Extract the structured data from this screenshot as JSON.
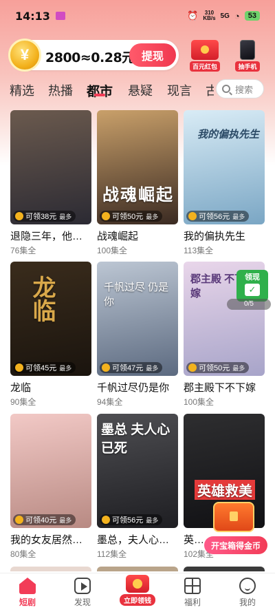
{
  "status_bar": {
    "time": "14:13",
    "net_speed": "310",
    "net_unit": "KB/s",
    "signal": "5G",
    "battery": "53"
  },
  "header": {
    "coin_amount": "2800≈0.28元",
    "withdraw_label": "提现",
    "promo_red_packet": "百元红包",
    "promo_phone": "抽手机"
  },
  "tabs": [
    {
      "label": "精选"
    },
    {
      "label": "热播"
    },
    {
      "label": "都市"
    },
    {
      "label": "悬疑"
    },
    {
      "label": "现言"
    },
    {
      "label": "古"
    }
  ],
  "search": {
    "placeholder": "搜索"
  },
  "dramas": [
    {
      "title": "退隐三年，他…",
      "episodes": "76集全",
      "reward": "可领38元",
      "reward_max": "最多",
      "colors": [
        "#6b5a4e",
        "#2b2a33"
      ]
    },
    {
      "title": "战魂崛起",
      "episodes": "100集全",
      "reward": "可领50元",
      "reward_max": "最多",
      "colors": [
        "#c9a06a",
        "#3a2a22"
      ],
      "poster_text": "战魂崛起"
    },
    {
      "title": "我的偏执先生",
      "episodes": "113集全",
      "reward": "可领56元",
      "reward_max": "最多",
      "colors": [
        "#d9ecf6",
        "#7aa6c4"
      ],
      "poster_text": "我的偏执先生"
    },
    {
      "title": "龙临",
      "episodes": "90集全",
      "reward": "可领45元",
      "reward_max": "最多",
      "colors": [
        "#3a2c1c",
        "#1a140e"
      ],
      "poster_text": "龙临"
    },
    {
      "title": "千帆过尽仍是你",
      "episodes": "94集全",
      "reward": "可领47元",
      "reward_max": "最多",
      "colors": [
        "#bcc6d3",
        "#5c6a80"
      ],
      "poster_text": "千帆过尽 仍是你"
    },
    {
      "title": "郡主殿下不下嫁",
      "episodes": "100集全",
      "reward": "可领50元",
      "reward_max": "最多",
      "colors": [
        "#e9d6ea",
        "#a7a4c9"
      ],
      "poster_text": "郡主殿 不下嫁"
    },
    {
      "title": "我的女友居然…",
      "episodes": "80集全",
      "reward": "可领40元",
      "reward_max": "最多",
      "colors": [
        "#f2c9c6",
        "#b88a83"
      ]
    },
    {
      "title": "墨总，夫人心…",
      "episodes": "112集全",
      "reward": "可领56元",
      "reward_max": "最多",
      "colors": [
        "#4e4e52",
        "#1e1e22"
      ],
      "poster_text": "墨总 夫人心已死"
    },
    {
      "title": "英雄救美",
      "episodes": "102集全",
      "reward": "",
      "reward_max": "",
      "colors": [
        "#2e2e30",
        "#111114"
      ],
      "poster_text": "英雄救美"
    }
  ],
  "float_widget": {
    "title": "领现",
    "check": "✓",
    "progress": "0/5"
  },
  "treasure": {
    "label": "开宝箱得金币"
  },
  "bottom_nav": [
    {
      "label": "短剧",
      "icon": "home-icon"
    },
    {
      "label": "发现",
      "icon": "play-icon"
    },
    {
      "label": "立即领钱",
      "icon": "red-envelope-icon"
    },
    {
      "label": "福利",
      "icon": "gift-icon"
    },
    {
      "label": "我的",
      "icon": "smile-icon"
    }
  ]
}
